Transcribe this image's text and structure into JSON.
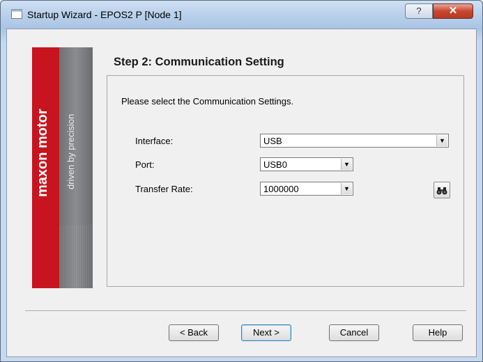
{
  "window": {
    "title": "Startup Wizard - EPOS2 P [Node 1]",
    "help_label": "?",
    "close_label": "✕"
  },
  "logo": {
    "brand": "maxon motor",
    "tagline": "driven by precision"
  },
  "step": {
    "title": "Step 2: Communication Setting",
    "instruction": "Please select the Communication Settings."
  },
  "fields": {
    "interface": {
      "label": "Interface:",
      "value": "USB"
    },
    "port": {
      "label": "Port:",
      "value": "USB0"
    },
    "transfer_rate": {
      "label": "Transfer Rate:",
      "value": "1000000"
    }
  },
  "icons": {
    "search": "binoculars-icon",
    "dropdown": "chevron-down-icon"
  },
  "buttons": {
    "back": "< Back",
    "next": "Next >",
    "cancel": "Cancel",
    "help": "Help"
  },
  "colors": {
    "brand_red": "#c8141e",
    "brand_grey": "#7a7c7f"
  }
}
